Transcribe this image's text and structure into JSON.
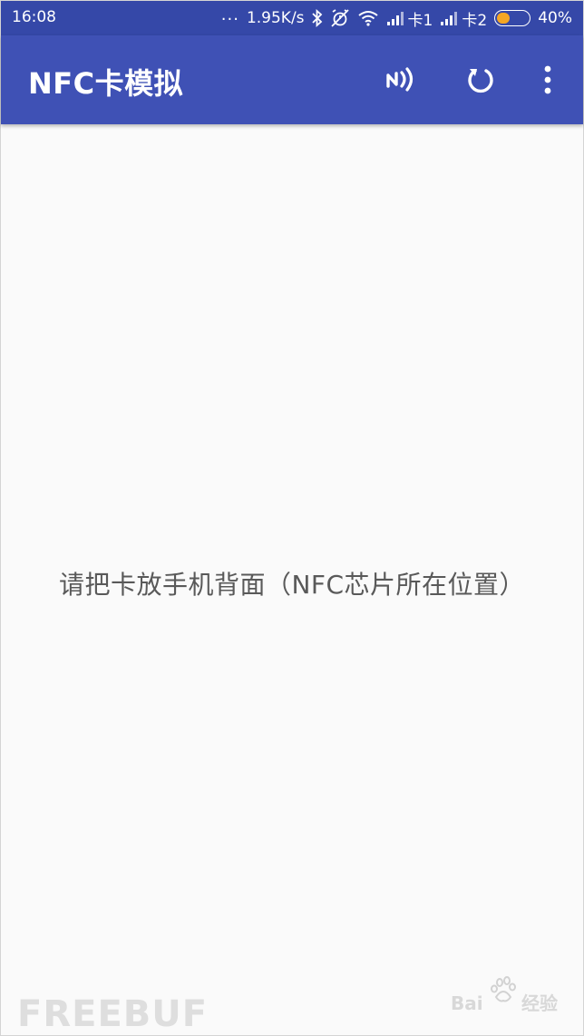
{
  "status_bar": {
    "time": "16:08",
    "more_dots": "...",
    "network_speed": "1.95K/s",
    "sim1_label": "卡1",
    "sim2_label": "卡2",
    "battery_percent": "40%",
    "battery_level": 0.4,
    "icons": [
      "bluetooth-icon",
      "alarm-off-icon",
      "wifi-icon",
      "signal-icon",
      "signal-icon",
      "battery-icon"
    ]
  },
  "app_bar": {
    "title": "NFC卡模拟",
    "actions": [
      "nfc-icon",
      "refresh-icon",
      "more-vert-icon"
    ]
  },
  "content": {
    "instruction": "请把卡放手机背面（NFC芯片所在位置）"
  },
  "watermarks": {
    "freebuf": "FREEBUF",
    "baidu": "Bai du 经验"
  },
  "colors": {
    "status_bar": "#3548a8",
    "app_bar": "#3f51b5",
    "background": "#fafafa",
    "text": "#595959",
    "battery_fill": "#f5a623"
  }
}
